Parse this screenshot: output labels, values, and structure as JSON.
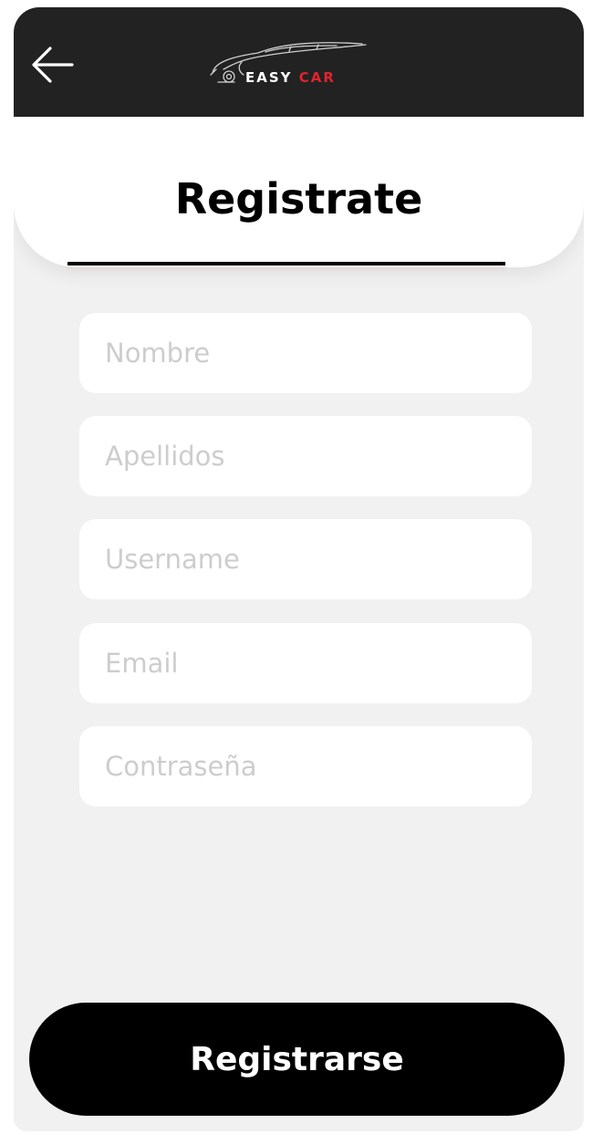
{
  "header": {
    "back_icon": "arrow-left-icon",
    "logo": {
      "text_primary": "EASY",
      "text_accent": "CAR",
      "accent_color": "#e0242c"
    },
    "background_color": "#222222"
  },
  "page": {
    "title": "Registrate"
  },
  "form": {
    "fields": [
      {
        "placeholder": "Nombre",
        "value": ""
      },
      {
        "placeholder": "Apellidos",
        "value": ""
      },
      {
        "placeholder": "Username",
        "value": ""
      },
      {
        "placeholder": "Email",
        "value": ""
      },
      {
        "placeholder": "Contraseña",
        "value": ""
      }
    ],
    "submit_label": "Registrarse"
  },
  "colors": {
    "screen_background": "#f1f1f1",
    "button_background": "#000000",
    "placeholder_text": "#cdcdcd"
  }
}
